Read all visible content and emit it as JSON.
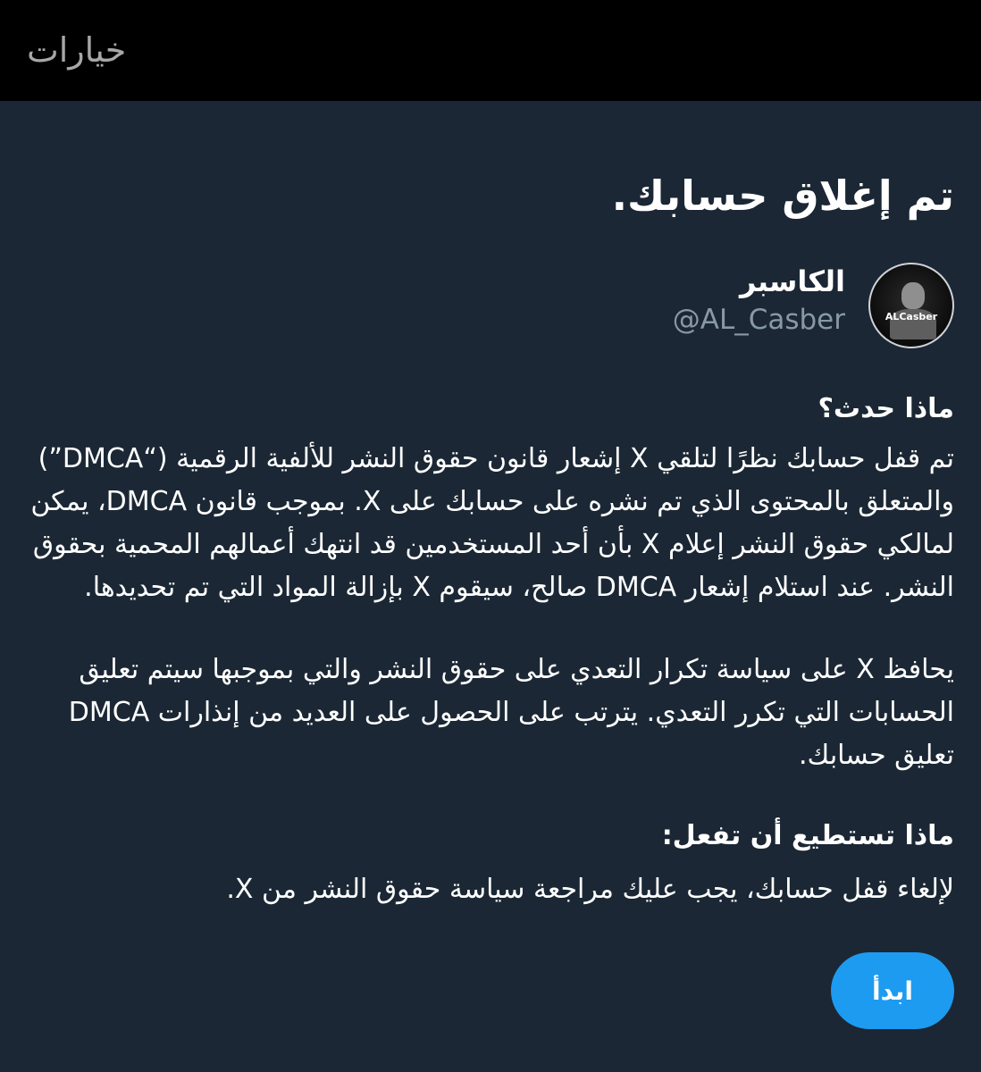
{
  "header": {
    "options_label": "خيارات"
  },
  "page": {
    "title": "تم إغلاق حسابك."
  },
  "account": {
    "display_name": "الكاسبر",
    "handle": "@AL_Casber",
    "avatar_text": "ALCasber"
  },
  "what_happened": {
    "heading": "ماذا حدث؟",
    "paragraph_1": "تم قفل حسابك نظرًا لتلقي X إشعار قانون حقوق النشر للألفية الرقمية (“DMCA”) والمتعلق بالمحتوى الذي تم نشره على حسابك على X. بموجب قانون DMCA، يمكن لمالكي حقوق النشر إعلام X بأن أحد المستخدمين قد انتهك أعمالهم المحمية بحقوق النشر. عند استلام إشعار DMCA صالح، سيقوم X بإزالة المواد التي تم تحديدها.",
    "paragraph_2": "يحافظ X على سياسة تكرار التعدي على حقوق النشر والتي بموجبها سيتم تعليق الحسابات التي تكرر التعدي. يترتب على الحصول على العديد من إنذارات DMCA تعليق حسابك."
  },
  "what_you_can_do": {
    "heading": "ماذا تستطيع أن تفعل:",
    "paragraph": "لإلغاء قفل حسابك، يجب عليك مراجعة سياسة حقوق النشر من X."
  },
  "actions": {
    "start_label": "ابدأ"
  },
  "colors": {
    "background": "#1b2734",
    "topbar": "#000000",
    "accent": "#1d9bf0",
    "secondary_text": "#8899a6"
  },
  "icons": {
    "avatar": "profile-avatar-image"
  }
}
